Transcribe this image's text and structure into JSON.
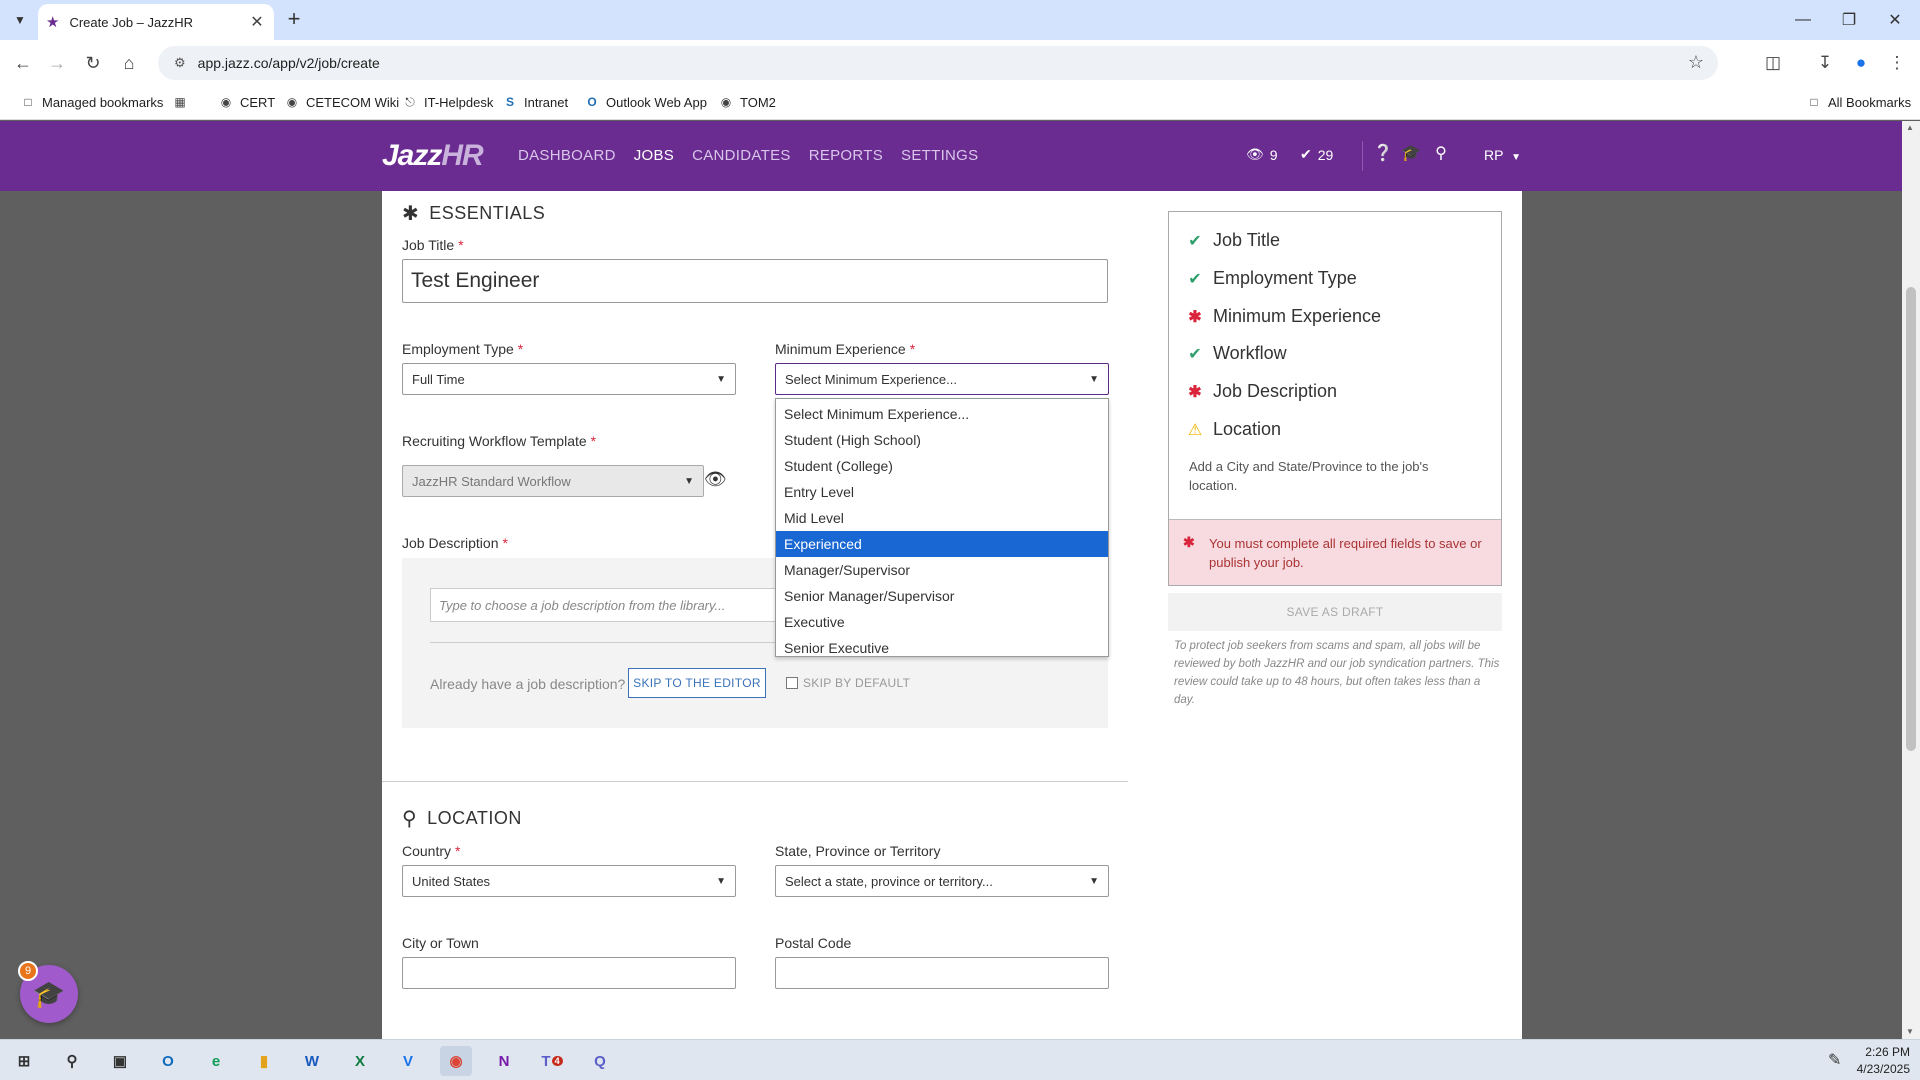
{
  "browser": {
    "tab_title": "Create Job – JazzHR",
    "url": "app.jazz.co/app/v2/job/create",
    "bookmarks": [
      "Managed bookmarks",
      "CERT",
      "CETECOM Wiki",
      "IT-Helpdesk",
      "Intranet",
      "Outlook Web App",
      "TOM2"
    ],
    "all_bookmarks": "All Bookmarks"
  },
  "nav": {
    "logo_jazz": "Jazz",
    "logo_hr": "HR",
    "links": [
      "DASHBOARD",
      "JOBS",
      "CANDIDATES",
      "REPORTS",
      "SETTINGS"
    ],
    "active_link": "JOBS",
    "views_count": "9",
    "checks_count": "29",
    "user_initials": "RP"
  },
  "essentials": {
    "title": "ESSENTIALS",
    "job_title_label": "Job Title",
    "job_title_value": "Test Engineer",
    "employment_type_label": "Employment Type",
    "employment_type_value": "Full Time",
    "min_experience_label": "Minimum Experience",
    "min_experience_value": "Select Minimum Experience...",
    "workflow_label": "Recruiting Workflow Template",
    "workflow_value": "JazzHR Standard Workflow",
    "job_description_label": "Job Description",
    "library_placeholder": "Type to choose a job description from the library...",
    "already_text": "Already have a job description?",
    "skip_button": "SKIP TO THE EDITOR",
    "skip_default": "SKIP BY DEFAULT"
  },
  "experience_options": [
    "Select Minimum Experience...",
    "Student (High School)",
    "Student (College)",
    "Entry Level",
    "Mid Level",
    "Experienced",
    "Manager/Supervisor",
    "Senior Manager/Supervisor",
    "Executive",
    "Senior Executive"
  ],
  "highlighted_option": "Experienced",
  "location": {
    "title": "LOCATION",
    "country_label": "Country",
    "country_value": "United States",
    "state_label": "State, Province or Territory",
    "state_value": "Select a state, province or territory...",
    "city_label": "City or Town",
    "postal_label": "Postal Code"
  },
  "checklist": {
    "items": [
      {
        "label": "Job Title",
        "status": "ok"
      },
      {
        "label": "Employment Type",
        "status": "ok"
      },
      {
        "label": "Minimum Experience",
        "status": "error"
      },
      {
        "label": "Workflow",
        "status": "ok"
      },
      {
        "label": "Job Description",
        "status": "error"
      },
      {
        "label": "Location",
        "status": "warning"
      }
    ],
    "location_note": "Add a City and State/Province to the job's location.",
    "alert": "You must complete all required fields to save or publish your job.",
    "save_draft": "SAVE AS DRAFT",
    "protect_note": "To protect job seekers from scams and spam, all jobs will be reviewed by both JazzHR and our job syndication partners. This review could take up to 48 hours, but often takes less than a day."
  },
  "notifications_badge": "9",
  "taskbar": {
    "time": "2:26 PM",
    "date": "4/23/2025",
    "teams_badge": "4"
  },
  "colors": {
    "brand_purple": "#6b2c91",
    "check_green": "#2e9e6b",
    "error_red": "#d9243b",
    "warning_yellow": "#f0b400",
    "highlight_blue": "#1967d2"
  }
}
